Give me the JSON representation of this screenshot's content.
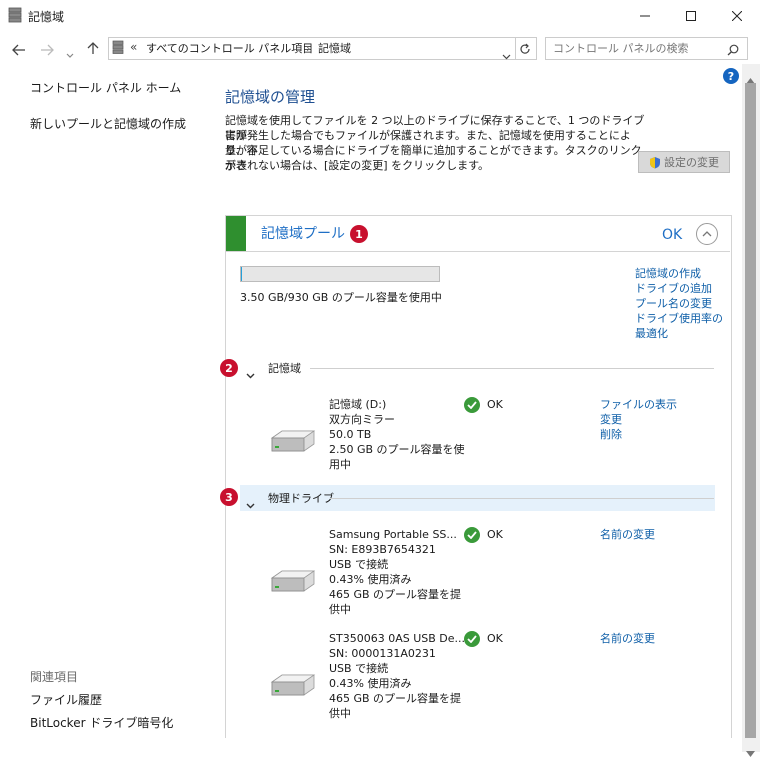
{
  "window": {
    "title": "記憶域"
  },
  "address": {
    "prefix": "«",
    "path": "すべてのコントロール パネル項目",
    "separator": "›",
    "current": "記憶域",
    "search_placeholder": "コントロール パネルの検索"
  },
  "leftnav": {
    "home": "コントロール パネル ホーム",
    "create": "新しいプールと記憶域の作成",
    "related_header": "関連項目",
    "file_history": "ファイル履歴",
    "bitlocker": "BitLocker ドライブ暗号化"
  },
  "main": {
    "heading": "記憶域の管理",
    "description_lines": [
      "記憶域を使用してファイルを 2 つ以上のドライブに保存することで、1 つのドライブに障",
      "害が発生した場合でもファイルが保護されます。また、記憶域を使用することにより、容",
      "量が不足している場合にドライブを簡単に追加することができます。タスクのリンクが表",
      "示されない場合は、[設定の変更] をクリックします。"
    ],
    "change_settings": "設定の変更"
  },
  "pool": {
    "title": "記憶域プール",
    "badge": "1",
    "status": "OK",
    "usage_fraction": 0.0038,
    "usage_text": "3.50 GB/930 GB のプール容量を使用中",
    "tasks": [
      "記憶域の作成",
      "ドライブの追加",
      "プール名の変更",
      "ドライブ使用率の",
      "最適化"
    ]
  },
  "spaces_section": {
    "badge": "2",
    "title": "記憶域",
    "item": {
      "lines": [
        "記憶域 (D:)",
        "双方向ミラー",
        "50.0 TB",
        "2.50 GB のプール容量を使",
        "用中"
      ],
      "status": "OK",
      "links": [
        "ファイルの表示",
        "変更",
        "削除"
      ]
    }
  },
  "drives_section": {
    "badge": "3",
    "title": "物理ドライブ",
    "drives": [
      {
        "lines": [
          "Samsung Portable SS...",
          "SN: E893B7654321",
          "USB で接続",
          "0.43% 使用済み",
          "465 GB のプール容量を提",
          "供中"
        ],
        "status": "OK",
        "link": "名前の変更"
      },
      {
        "lines": [
          "ST350063 0AS USB De...",
          "SN: 0000131A0231",
          "USB で接続",
          "0.43% 使用済み",
          "465 GB のプール容量を提",
          "供中"
        ],
        "status": "OK",
        "link": "名前の変更"
      }
    ]
  },
  "colors": {
    "link": "#0f5fa8",
    "accent_green": "#2f8f2f",
    "badge_red": "#c8102e",
    "section_highlight": "#e5f1fb"
  }
}
